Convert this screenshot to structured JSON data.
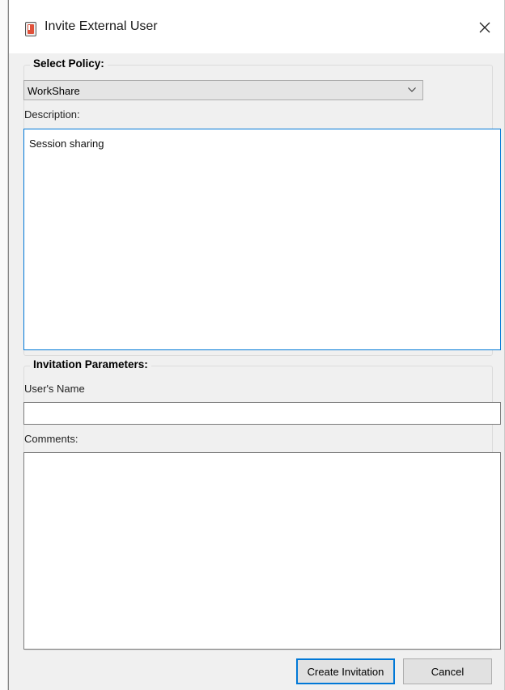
{
  "window": {
    "title": "Invite External User"
  },
  "policy": {
    "section_title": "Select Policy:",
    "selected": "WorkShare",
    "description_label": "Description:",
    "description_text": "Session sharing"
  },
  "invitation": {
    "section_title": "Invitation Parameters:",
    "name_label": "User's Name",
    "name_value": "",
    "comments_label": "Comments:",
    "comments_value": ""
  },
  "buttons": {
    "create": "Create Invitation",
    "cancel": "Cancel"
  },
  "colors": {
    "focus_accent": "#0078d7",
    "dialog_bg": "#f0f0f0",
    "button_bg": "#e1e1e1"
  },
  "icons": {
    "app": "app-icon",
    "close": "close-icon",
    "dropdown": "chevron-down-icon"
  }
}
